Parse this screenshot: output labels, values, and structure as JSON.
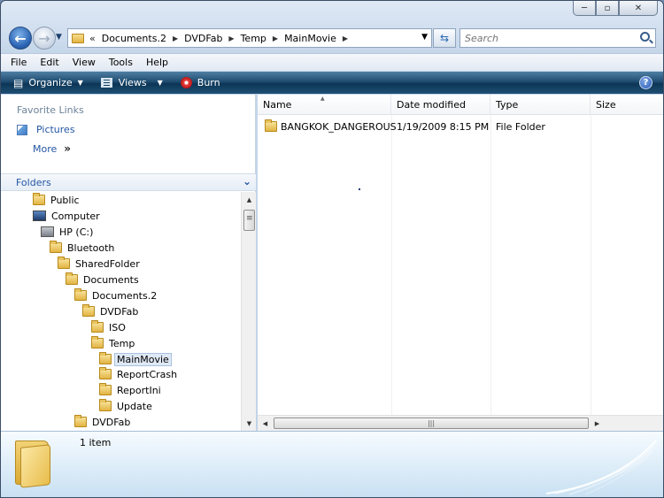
{
  "window": {
    "minimize": "─",
    "maximize": "▫",
    "close": "✕"
  },
  "address": {
    "prefix": "«",
    "crumbs": [
      "Documents.2",
      "DVDFab",
      "Temp",
      "MainMovie"
    ],
    "search_placeholder": "Search"
  },
  "menu": [
    "File",
    "Edit",
    "View",
    "Tools",
    "Help"
  ],
  "toolbar": {
    "organize": "Organize",
    "views": "Views",
    "burn": "Burn",
    "help": "?"
  },
  "nav": {
    "favorites_title": "Favorite Links",
    "pictures": "Pictures",
    "more": "More",
    "more_chevron": "»",
    "folders_title": "Folders",
    "tree": [
      {
        "label": "Public",
        "icon": "folder-icon",
        "depth": 0
      },
      {
        "label": "Computer",
        "icon": "computer-icon",
        "depth": 0
      },
      {
        "label": "HP (C:)",
        "icon": "drive-icon",
        "depth": 1
      },
      {
        "label": "Bluetooth",
        "icon": "folder-icon",
        "depth": 2
      },
      {
        "label": "SharedFolder",
        "icon": "folder-icon",
        "depth": 3
      },
      {
        "label": "Documents",
        "icon": "folder-icon",
        "depth": 4
      },
      {
        "label": "Documents.2",
        "icon": "folder-icon",
        "depth": 5
      },
      {
        "label": "DVDFab",
        "icon": "folder-icon",
        "depth": 6
      },
      {
        "label": "ISO",
        "icon": "folder-icon",
        "depth": 7
      },
      {
        "label": "Temp",
        "icon": "folder-icon",
        "depth": 7
      },
      {
        "label": "MainMovie",
        "icon": "folder-icon",
        "depth": 8,
        "selected": true
      },
      {
        "label": "ReportCrash",
        "icon": "folder-icon",
        "depth": 8
      },
      {
        "label": "ReportIni",
        "icon": "folder-icon",
        "depth": 8
      },
      {
        "label": "Update",
        "icon": "folder-icon",
        "depth": 8
      },
      {
        "label": "DVDFab",
        "icon": "folder-icon",
        "depth": 5
      }
    ]
  },
  "files": {
    "columns": [
      "Name",
      "Date modified",
      "Type",
      "Size"
    ],
    "rows": [
      {
        "name": "BANGKOK_DANGEROUS",
        "date": "1/19/2009 8:15 PM",
        "type": "File Folder",
        "size": ""
      }
    ]
  },
  "details": {
    "count": "1 item"
  }
}
